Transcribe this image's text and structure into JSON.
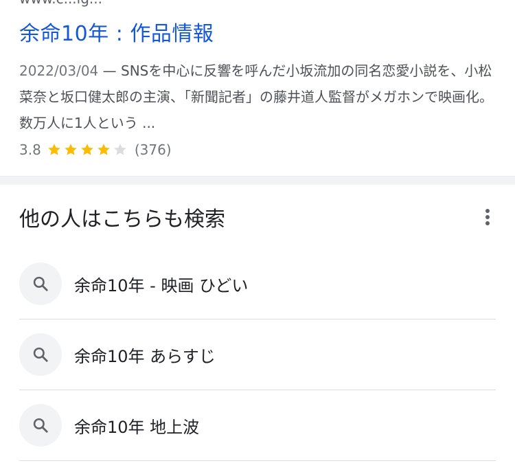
{
  "result": {
    "breadcrumb_cutoff": "www.c...ig...",
    "title": "余命10年 : 作品情報",
    "snippet_date": "2022/03/04",
    "snippet_separator": " — ",
    "snippet_text": "SNSを中心に反響を呼んだ小坂流加の同名恋愛小説を、小松菜奈と坂口健太郎の主演、「新聞記者」の藤井道人監督がメガホンで映画化。数万人に1人という ...",
    "rating_score": "3.8",
    "rating_stars": 4,
    "rating_max": 5,
    "rating_count": "(376)",
    "star_color": "#fbbc04",
    "star_empty_color": "#dadce0",
    "link_color": "#1558d6"
  },
  "related": {
    "title": "他の人はこちらも検索",
    "more_icon": "more-vert-icon",
    "search_icon": "search-icon",
    "items": [
      {
        "label": "余命10年 - 映画 ひどい"
      },
      {
        "label": "余命10年 あらすじ"
      },
      {
        "label": "余命10年 地上波"
      }
    ]
  }
}
